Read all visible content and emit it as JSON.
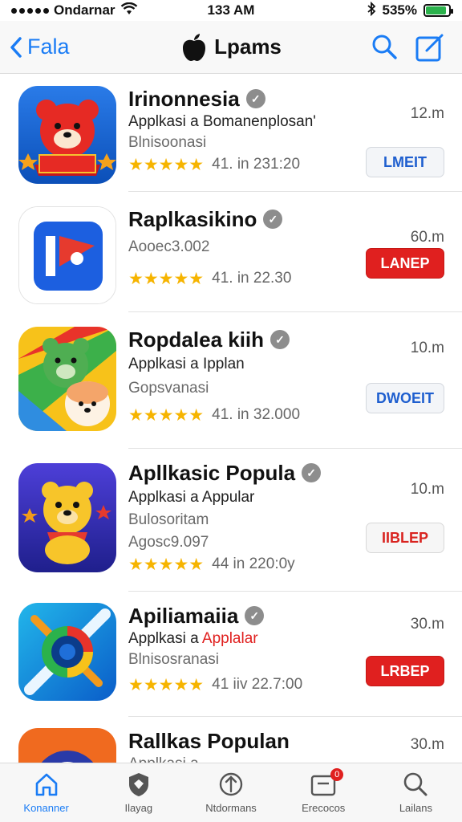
{
  "status": {
    "carrier": "Ondarnar",
    "time": "133 AM",
    "battery": "535%",
    "battery_fill": 0.9
  },
  "nav": {
    "back_label": "Fala",
    "title": "Lpams"
  },
  "apps": [
    {
      "name": "Irinonnesia",
      "line1": "Applkasi a Bomanenplosan'",
      "line2": "Blnisoonasi",
      "rating_text": "41. in 231:20",
      "size": "12.m",
      "button": "LMEIT"
    },
    {
      "name": "Raplkasikino",
      "line1": "Aooec3.002",
      "rating_text": "41. in 22.30",
      "size": "60.m",
      "button": "LANEP"
    },
    {
      "name": "Ropdalea kiih",
      "line1": "Applkasi a Ipplan",
      "line2": "Gopsvanasi",
      "rating_text": "41. in 32.000",
      "size": "10.m",
      "button": "DWOEIT"
    },
    {
      "name": "Apllkasic Popula",
      "line1": "Applkasi a Appular",
      "line2": "Bulosoritam",
      "line3": "Agosc9.097",
      "rating_text": "44 in 220:0y",
      "size": "10.m",
      "button": "IIBLEP"
    },
    {
      "name": "Apiliamaiia",
      "line1_prefix": "Applkasi a ",
      "line1_accent": "Applalar",
      "line2": "Blnisosranasi",
      "rating_text": "41 iiv 22.7:00",
      "size": "30.m",
      "button": "LRBEP"
    },
    {
      "name": "Rallkas Populan",
      "line1": "Applkasi a",
      "size": "30.m"
    }
  ],
  "tabs": [
    {
      "label": "Konanner",
      "icon": "home-icon"
    },
    {
      "label": "Ilayag",
      "icon": "shield-icon"
    },
    {
      "label": "Ntdormans",
      "icon": "compass-icon"
    },
    {
      "label": "Erecocos",
      "icon": "updates-icon",
      "badge": "0"
    },
    {
      "label": "Lailans",
      "icon": "search-icon"
    }
  ],
  "colors": {
    "accent": "#1a7cf5",
    "button_red": "#e0201f",
    "star": "#f6b400"
  }
}
